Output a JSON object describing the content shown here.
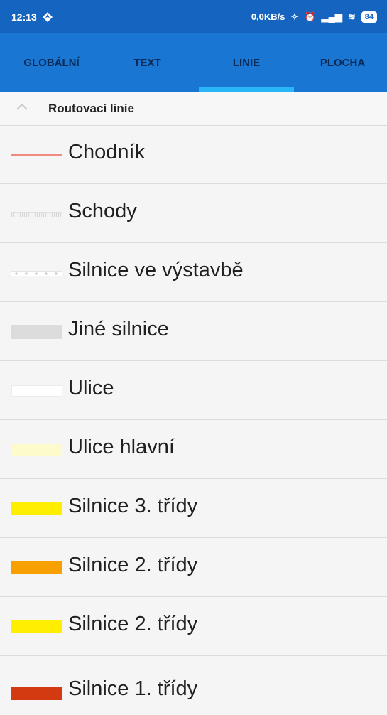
{
  "status_bar": {
    "time": "12:13",
    "net_speed": "0,0KB/s",
    "battery": "84"
  },
  "tabs": [
    {
      "label": "GLOBÁLNÍ",
      "active": false
    },
    {
      "label": "TEXT",
      "active": false
    },
    {
      "label": "LINIE",
      "active": true
    },
    {
      "label": "PLOCHA",
      "active": false
    }
  ],
  "section": {
    "title": "Routovací linie"
  },
  "items": [
    {
      "label": "Chodník",
      "color": "#ef8c80"
    },
    {
      "label": "Schody",
      "color": "#d6d6d6"
    },
    {
      "label": "Silnice ve výstavbě",
      "color": "#cfcfcf"
    },
    {
      "label": "Jiné silnice",
      "color": "#dcdcdc"
    },
    {
      "label": "Ulice",
      "color": "#ffffff"
    },
    {
      "label": "Ulice hlavní",
      "color": "#fdfacc"
    },
    {
      "label": "Silnice 3. třídy",
      "color": "#ffee00"
    },
    {
      "label": "Silnice 2. třídy",
      "color": "#f8a000"
    },
    {
      "label": "Silnice 2. třídy",
      "color": "#ffee00"
    },
    {
      "label": "Silnice 1. třídy",
      "color": "#d43a12"
    }
  ],
  "colors": {
    "statusbar": "#1565c0",
    "tabbar": "#1976d2",
    "tab_indicator": "#29b6f6"
  }
}
